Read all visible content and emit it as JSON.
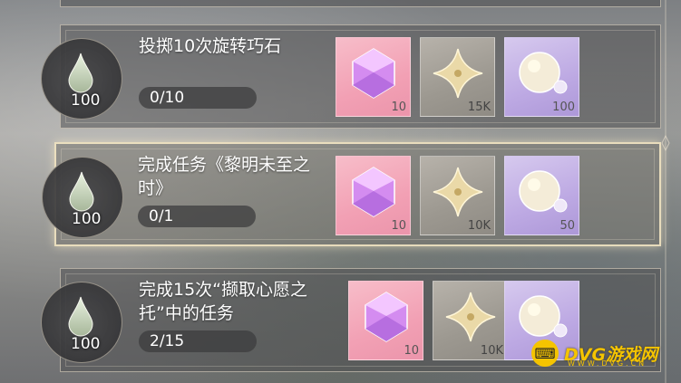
{
  "tasks": [
    {
      "title": "投掷10次旋转巧石",
      "drop_count": "100",
      "progress": "0/10",
      "rewards": [
        {
          "icon": "pink-crystal-icon",
          "qty": "10"
        },
        {
          "icon": "gold-star-icon",
          "qty": "15K"
        },
        {
          "icon": "pearl-bubble-icon",
          "qty": "100"
        }
      ]
    },
    {
      "title": "完成任务《黎明未至之时》",
      "drop_count": "100",
      "progress": "0/1",
      "rewards": [
        {
          "icon": "pink-crystal-icon",
          "qty": "10"
        },
        {
          "icon": "gold-star-icon",
          "qty": "10K"
        },
        {
          "icon": "pearl-bubble-icon",
          "qty": "50"
        }
      ]
    },
    {
      "title": "完成15次“撷取心愿之托”中的任务",
      "drop_count": "100",
      "progress": "2/15",
      "rewards": [
        {
          "icon": "pink-crystal-icon",
          "qty": "10"
        },
        {
          "icon": "gold-star-icon",
          "qty": "10K"
        },
        {
          "icon": "pearl-bubble-icon",
          "qty": ""
        }
      ]
    }
  ],
  "watermark": {
    "brand": "DVG游戏网",
    "url": "WWW.DVG.CN"
  },
  "colors": {
    "accent_gold": "#f5c400",
    "crystal_pink": "#f2a0b4",
    "star_tile": "#9c9890",
    "pearl_tile": "#bda9e3"
  }
}
